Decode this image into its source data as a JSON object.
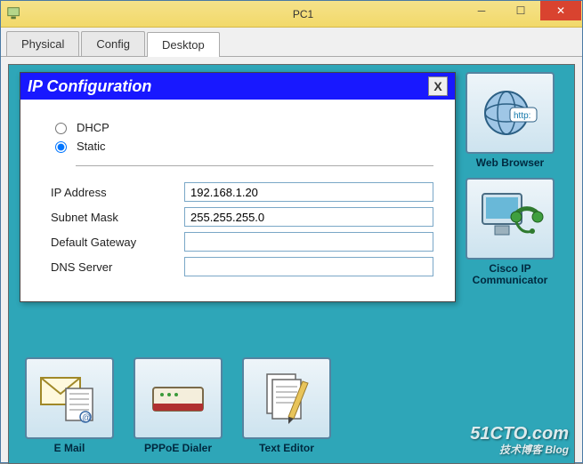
{
  "window": {
    "title": "PC1"
  },
  "tabs": {
    "physical": "Physical",
    "config": "Config",
    "desktop": "Desktop"
  },
  "dialog": {
    "title": "IP Configuration",
    "close": "X",
    "radios": {
      "dhcp": "DHCP",
      "static": "Static",
      "selected": "Static"
    },
    "fields": {
      "ip": {
        "label": "IP Address",
        "value": "192.168.1.20"
      },
      "mask": {
        "label": "Subnet Mask",
        "value": "255.255.255.0"
      },
      "gw": {
        "label": "Default Gateway",
        "value": ""
      },
      "dns": {
        "label": "DNS Server",
        "value": ""
      }
    }
  },
  "launchers": {
    "web": "Web Browser",
    "cisco": "Cisco IP Communicator",
    "email": "E Mail",
    "pppoe": "PPPoE Dialer",
    "text": "Text Editor"
  },
  "watermark": {
    "main": "51CTO.com",
    "sub": "技术博客  Blog"
  }
}
